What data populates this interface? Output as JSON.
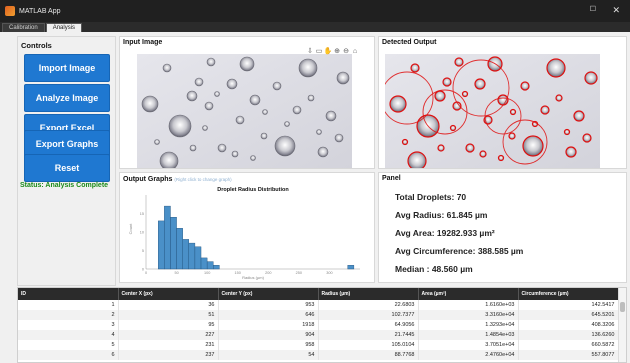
{
  "window": {
    "title": "MATLAB App",
    "maximize_glyph": "☐",
    "close_glyph": "✕"
  },
  "tabs": [
    {
      "label": "Calibration",
      "active": false
    },
    {
      "label": "Analysis",
      "active": true
    }
  ],
  "controls": {
    "title": "Controls",
    "buttons": [
      {
        "label": "Import Image"
      },
      {
        "label": "Analyze Image"
      },
      {
        "label": "Export Excel"
      },
      {
        "label": "Export Graphs"
      },
      {
        "label": "Reset"
      }
    ],
    "status": "Status: Analysis Complete",
    "button_color": "#1f78d1",
    "status_color": "#1a8a1a"
  },
  "input_image": {
    "title": "Input Image",
    "toolbar_icons": [
      "save-icon",
      "data-tip-icon",
      "pan-icon",
      "zoom-in-icon",
      "zoom-out-icon",
      "home-icon"
    ]
  },
  "detected_output": {
    "title": "Detected Output",
    "marker_color": "#e01010"
  },
  "output_graphs": {
    "title": "Output Graphs",
    "hint": "(Right click to change graph)"
  },
  "chart_data": {
    "type": "bar",
    "title": "Droplet Radius Distribution",
    "xlabel": "Radius (µm)",
    "ylabel": "Count",
    "xlim": [
      0,
      350
    ],
    "ylim": [
      0,
      20
    ],
    "xticks": [
      "0",
      "50",
      "100",
      "150",
      "200",
      "250",
      "300"
    ],
    "yticks": [
      "0",
      "5",
      "10",
      "15"
    ],
    "bin_width": 10,
    "bins": [
      {
        "start": 20,
        "count": 13
      },
      {
        "start": 30,
        "count": 17
      },
      {
        "start": 40,
        "count": 14
      },
      {
        "start": 50,
        "count": 11
      },
      {
        "start": 60,
        "count": 8
      },
      {
        "start": 70,
        "count": 7
      },
      {
        "start": 80,
        "count": 6
      },
      {
        "start": 90,
        "count": 3
      },
      {
        "start": 100,
        "count": 2
      },
      {
        "start": 110,
        "count": 1
      },
      {
        "start": 330,
        "count": 1
      }
    ],
    "bar_color": "#4a90c8"
  },
  "panel": {
    "title": "Panel",
    "stats": [
      "Total Droplets: 70",
      "Avg Radius: 61.845 µm",
      "Avg Area: 19282.933 µm²",
      "Avg Circumference: 388.585 µm",
      "Median : 48.560 µm"
    ]
  },
  "table": {
    "columns": [
      "ID",
      "Center X (px)",
      "Center Y (px)",
      "Radius (µm)",
      "Area (µm²)",
      "Circumference (µm)"
    ],
    "rows": [
      [
        "1",
        "36",
        "953",
        "22.6803",
        "1.6160e+03",
        "142.5417"
      ],
      [
        "2",
        "51",
        "646",
        "102.7377",
        "3.3160e+04",
        "645.5201"
      ],
      [
        "3",
        "95",
        "1918",
        "64.9056",
        "1.3293e+04",
        "408.3206"
      ],
      [
        "4",
        "227",
        "904",
        "21.7445",
        "1.4854e+03",
        "136.6260"
      ],
      [
        "5",
        "231",
        "958",
        "105.0104",
        "3.7051e+04",
        "660.5872"
      ],
      [
        "6",
        "237",
        "54",
        "88.7768",
        "2.4760e+04",
        "557.8077"
      ]
    ]
  }
}
